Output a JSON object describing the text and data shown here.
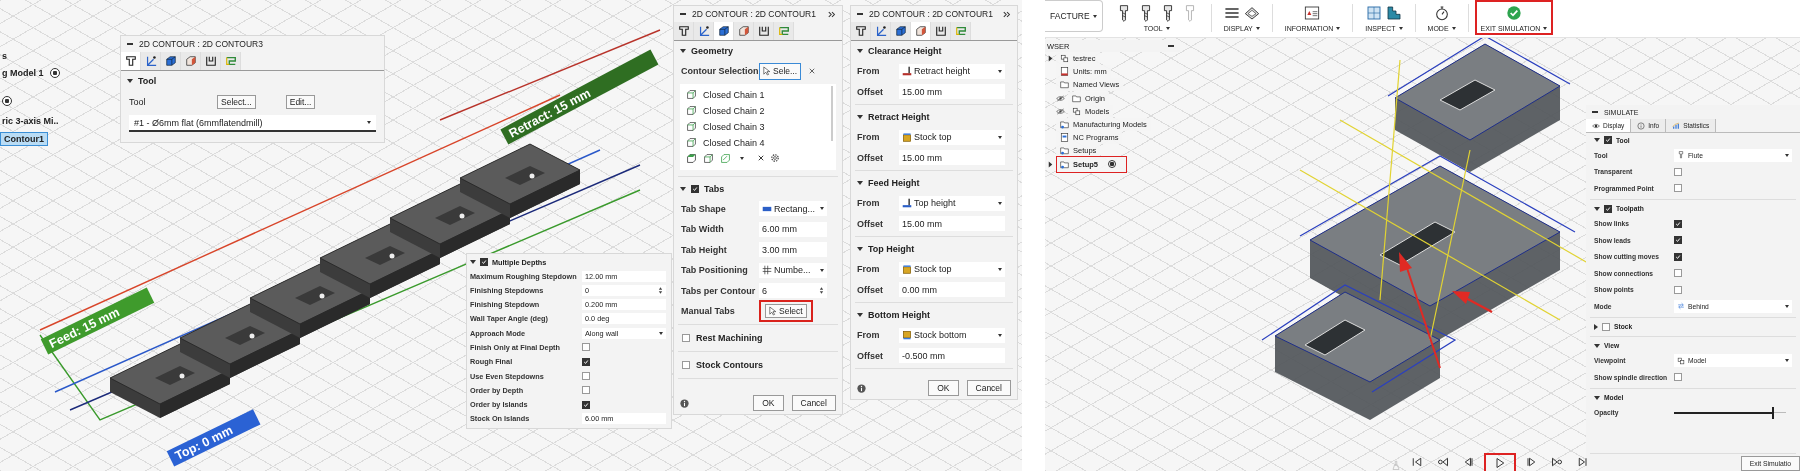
{
  "left_view": {
    "browser_items": [
      {
        "label": "s",
        "selected": false
      },
      {
        "label": "g Model 1",
        "selected": false
      },
      {
        "label": "ric 3-axis Mi..",
        "selected": false
      },
      {
        "label": "Contour1",
        "selected": true
      }
    ],
    "viewport_labels": [
      {
        "text": "Retract: 15 mm",
        "color": "#2f6e22"
      },
      {
        "text": "Feed: 15 mm",
        "color": "#3f9b2c"
      },
      {
        "text": "Top: 0 mm",
        "color": "#2b62d4"
      }
    ],
    "tool_panel": {
      "title": "2D CONTOUR : 2D CONTOUR3",
      "tabs": [
        {
          "selected": true
        },
        {
          "selected": false
        },
        {
          "selected": false
        },
        {
          "selected": false
        },
        {
          "selected": false
        },
        {
          "selected": false
        }
      ],
      "section": "Tool",
      "expanded": true,
      "label": "Tool",
      "buttons": [
        "Select...",
        "Edit..."
      ],
      "tool": "#1 - Ø6mm flat (6mmflatendmill)"
    },
    "depths_panel": {
      "title": "Multiple Depths",
      "checked": true,
      "expanded": true,
      "rows": [
        {
          "label": "Maximum Roughing Stepdown",
          "kind": "text",
          "value": "12.00 mm"
        },
        {
          "label": "Finishing Stepdowns",
          "kind": "spinner",
          "value": "0"
        },
        {
          "label": "Finishing Stepdown",
          "kind": "text",
          "value": "0.200 mm"
        },
        {
          "label": "Wall Taper Angle (deg)",
          "kind": "text",
          "value": "0.0 deg"
        },
        {
          "label": "Approach Mode",
          "kind": "dropdown",
          "value": "Along wall"
        },
        {
          "label": "Finish Only at Final Depth",
          "kind": "checkbox",
          "checked": false
        },
        {
          "label": "Rough Final",
          "kind": "checkbox",
          "checked": true
        },
        {
          "label": "Use Even Stepdowns",
          "kind": "checkbox",
          "checked": false
        },
        {
          "label": "Order by Depth",
          "kind": "checkbox",
          "checked": false
        },
        {
          "label": "Order by Islands",
          "kind": "checkbox",
          "checked": true
        },
        {
          "label": "Stock On Islands",
          "kind": "text",
          "value": "6.00 mm"
        }
      ]
    },
    "geometry_panel": {
      "title": "2D CONTOUR : 2D CONTOUR1",
      "tabs": [
        {
          "selected": false
        },
        {
          "selected": false
        },
        {
          "selected": true
        },
        {
          "selected": false
        },
        {
          "selected": false
        },
        {
          "selected": false
        }
      ],
      "geometry": {
        "title": "Geometry",
        "expanded": true,
        "selection_label": "Contour Selection",
        "selection_button": "Sele...",
        "chains": [
          "Closed Chain 1",
          "Closed Chain 2",
          "Closed Chain 3",
          "Closed Chain 4"
        ]
      },
      "tabs_section": {
        "title": "Tabs",
        "checked": true,
        "expanded": true,
        "rows": [
          {
            "label": "Tab Shape",
            "kind": "dropdown",
            "value": "Rectang..."
          },
          {
            "label": "Tab Width",
            "kind": "text",
            "value": "6.00 mm"
          },
          {
            "label": "Tab Height",
            "kind": "text",
            "value": "3.00 mm"
          },
          {
            "label": "Tab Positioning",
            "kind": "dropdown",
            "value": "Numbe..."
          },
          {
            "label": "Tabs per Contour",
            "kind": "spinner",
            "value": "6"
          },
          {
            "label": "Manual Tabs",
            "kind": "button",
            "value": "Select",
            "highlighted": true
          }
        ]
      },
      "options": [
        {
          "label": "Rest Machining",
          "checked": false
        },
        {
          "label": "Stock Contours",
          "checked": false
        }
      ],
      "buttons": [
        "OK",
        "Cancel"
      ]
    },
    "heights_panel": {
      "title": "2D CONTOUR : 2D CONTOUR1",
      "tabs": [
        {
          "selected": false
        },
        {
          "selected": false
        },
        {
          "selected": false
        },
        {
          "selected": true
        },
        {
          "selected": false
        },
        {
          "selected": false
        }
      ],
      "sections": [
        {
          "title": "Clearance Height",
          "expanded": true,
          "from_label": "From",
          "from": "Retract height",
          "offset_label": "Offset",
          "offset": "15.00 mm"
        },
        {
          "title": "Retract Height",
          "expanded": true,
          "from_label": "From",
          "from": "Stock top",
          "offset_label": "Offset",
          "offset": "15.00 mm"
        },
        {
          "title": "Feed Height",
          "expanded": true,
          "from_label": "From",
          "from": "Top height",
          "offset_label": "Offset",
          "offset": "15.00 mm"
        },
        {
          "title": "Top Height",
          "expanded": true,
          "from_label": "From",
          "from": "Stock top",
          "offset_label": "Offset",
          "offset": "0.00 mm"
        },
        {
          "title": "Bottom Height",
          "expanded": true,
          "from_label": "From",
          "from": "Stock bottom",
          "offset_label": "Offset",
          "offset": "-0.500 mm"
        }
      ],
      "buttons": [
        "OK",
        "Cancel"
      ]
    }
  },
  "right_view": {
    "toolbar": [
      {
        "label": "FACTURE",
        "kind": "workspace"
      },
      {
        "label": "TOOL",
        "kind": "tool",
        "highlighted": false
      },
      {
        "label": "DISPLAY",
        "kind": "display",
        "highlighted": false
      },
      {
        "label": "INFORMATION",
        "kind": "information",
        "highlighted": false
      },
      {
        "label": "INSPECT",
        "kind": "inspect",
        "highlighted": false
      },
      {
        "label": "MODE",
        "kind": "mode",
        "highlighted": false
      },
      {
        "label": "EXIT SIMULATION",
        "kind": "exit",
        "highlighted": true
      }
    ],
    "browser": {
      "title": "WSER",
      "items": [
        {
          "label": "testrec",
          "kind": "component",
          "expandable": true,
          "eye": false,
          "highlighted": false
        },
        {
          "label": "Units: mm",
          "kind": "units",
          "expandable": false,
          "eye": false,
          "highlighted": false
        },
        {
          "label": "Named Views",
          "kind": "folder",
          "expandable": false,
          "eye": false,
          "highlighted": false
        },
        {
          "label": "Origin",
          "kind": "folder",
          "expandable": false,
          "eye": true,
          "highlighted": false
        },
        {
          "label": "Models",
          "kind": "component",
          "expandable": false,
          "eye": true,
          "highlighted": false
        },
        {
          "label": "Manufacturing Models",
          "kind": "mfg",
          "expandable": false,
          "eye": false,
          "highlighted": false
        },
        {
          "label": "NC Programs",
          "kind": "nc",
          "expandable": false,
          "eye": false,
          "highlighted": false
        },
        {
          "label": "Setups",
          "kind": "setups",
          "expandable": false,
          "eye": false,
          "highlighted": false
        },
        {
          "label": "Setup5",
          "kind": "setups",
          "expandable": true,
          "eye": false,
          "highlighted": true
        }
      ]
    },
    "simulate_panel": {
      "title": "SIMULATE",
      "tabs": [
        {
          "label": "Display",
          "selected": true
        },
        {
          "label": "Info",
          "selected": false
        },
        {
          "label": "Statistics",
          "selected": false
        }
      ],
      "sections": [
        {
          "title": "Tool",
          "checkbox": true,
          "checked": true,
          "expanded": true,
          "rows": [
            {
              "label": "Tool",
              "kind": "dropdown",
              "value": "Flute"
            },
            {
              "label": "Transparent",
              "kind": "checkbox",
              "checked": false
            },
            {
              "label": "Programmed Point",
              "kind": "checkbox",
              "checked": false
            }
          ]
        },
        {
          "title": "Toolpath",
          "checkbox": true,
          "checked": true,
          "expanded": true,
          "rows": [
            {
              "label": "Show links",
              "kind": "checkbox",
              "checked": true
            },
            {
              "label": "Show leads",
              "kind": "checkbox",
              "checked": true
            },
            {
              "label": "Show cutting moves",
              "kind": "checkbox",
              "checked": true
            },
            {
              "label": "Show connections",
              "kind": "checkbox",
              "checked": false
            },
            {
              "label": "Show points",
              "kind": "checkbox",
              "checked": false
            },
            {
              "label": "Mode",
              "kind": "dropdown",
              "value": "Behind"
            }
          ]
        },
        {
          "title": "Stock",
          "checkbox": true,
          "checked": false,
          "expanded": false
        },
        {
          "title": "View",
          "checkbox": false,
          "expanded": true,
          "rows": [
            {
              "label": "Viewpoint",
              "kind": "dropdown",
              "value": "Model"
            },
            {
              "label": "Show spindle direction",
              "kind": "checkbox",
              "checked": false
            }
          ]
        },
        {
          "title": "Model",
          "checkbox": false,
          "expanded": true,
          "rows": [
            {
              "label": "Opacity",
              "kind": "slider",
              "level": 0.88
            }
          ]
        }
      ],
      "button": "Exit Simulatio"
    },
    "playback": [
      {
        "highlighted": false
      },
      {
        "highlighted": false
      },
      {
        "highlighted": false
      },
      {
        "highlighted": true
      },
      {
        "highlighted": false
      },
      {
        "highlighted": false
      },
      {
        "highlighted": false
      }
    ]
  }
}
